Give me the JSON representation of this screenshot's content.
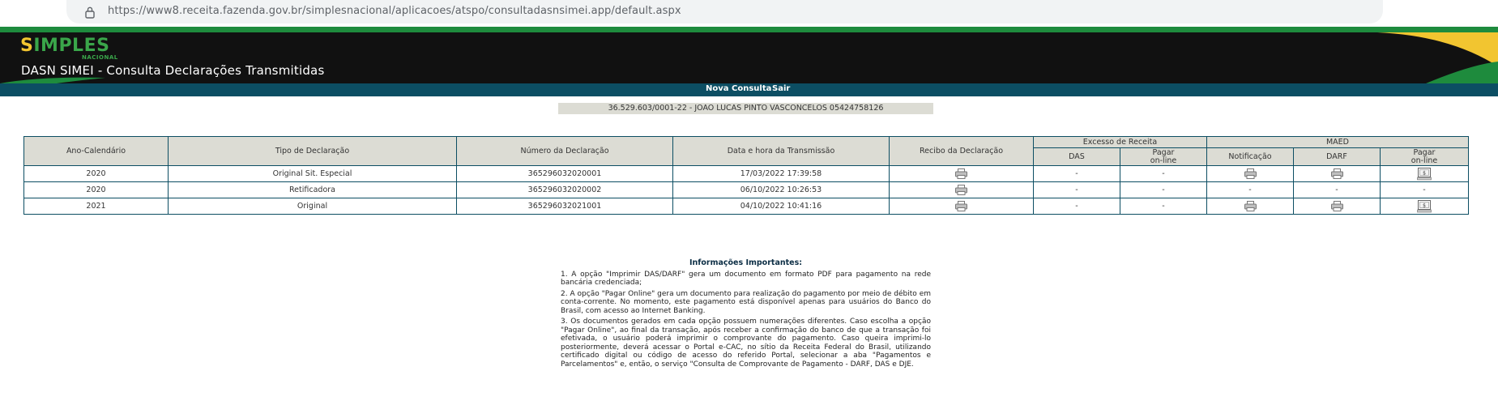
{
  "browser": {
    "url": "https://www8.receita.fazenda.gov.br/simplesnacional/aplicacoes/atspo/consultadasnsimei.app/default.aspx"
  },
  "header": {
    "logo_text": "IMPLES",
    "logo_letter": "S",
    "logo_sub": "NACIONAL",
    "title": "DASN SIMEI - Consulta Declarações Transmitidas"
  },
  "nav": {
    "new_query": "Nova Consulta",
    "exit": "Sair"
  },
  "identity": "36.529.603/0001-22 - JOAO LUCAS PINTO VASCONCELOS 05424758126",
  "table": {
    "headers": {
      "year": "Ano-Calendário",
      "type": "Tipo de Declaração",
      "number": "Número da Declaração",
      "datetime": "Data e hora da Transmissão",
      "receipt": "Recibo da Declaração",
      "excess": "Excesso de Receita",
      "excess_das": "DAS",
      "excess_pay_line1": "Pagar",
      "excess_pay_line2": "on-line",
      "maed": "MAED",
      "maed_notification": "Notificação",
      "maed_darf": "DARF",
      "maed_pay_line1": "Pagar",
      "maed_pay_line2": "on-line"
    },
    "rows": [
      {
        "year": "2020",
        "type": "Original Sit. Especial",
        "number": "365296032020001",
        "datetime": "17/03/2022 17:39:58",
        "excess_das": "-",
        "excess_pay": "-"
      },
      {
        "year": "2020",
        "type": "Retificadora",
        "number": "365296032020002",
        "datetime": "06/10/2022 10:26:53",
        "excess_das": "-",
        "excess_pay": "-",
        "maed_notification": "-",
        "maed_darf": "-",
        "maed_pay": "-"
      },
      {
        "year": "2021",
        "type": "Original",
        "number": "365296032021001",
        "datetime": "04/10/2022 10:41:16",
        "excess_das": "-",
        "excess_pay": "-"
      }
    ]
  },
  "info": {
    "title": "Informações Importantes:",
    "items": [
      "1. A opção \"Imprimir DAS/DARF\" gera um documento em formato PDF para pagamento na rede bancária credenciada;",
      "2. A opção \"Pagar Online\" gera um documento para realização do pagamento por meio de débito em conta-corrente. No momento, este pagamento está disponível apenas para usuários do Banco do Brasil, com acesso ao Internet Banking.",
      "3. Os documentos gerados em cada opção possuem numerações diferentes. Caso escolha a opção \"Pagar Online\", ao final da transação, após receber a confirmação do banco de que a transação foi efetivada, o usuário poderá imprimir o comprovante do pagamento. Caso queira imprimi-lo posteriormente, deverá acessar o Portal e-CAC, no sítio da Receita Federal do Brasil, utilizando certificado digital ou código de acesso do referido Portal, selecionar a aba \"Pagamentos e Parcelamentos\" e, então, o serviço \"Consulta de Comprovante de Pagamento - DARF, DAS e DJE."
    ]
  },
  "colors": {
    "navbar": "#0c4e63",
    "header_bg": "#111111",
    "green_stripe": "#1e8b3d",
    "table_header_bg": "#dcdcd4",
    "logo_green": "#3aa64a",
    "logo_yellow": "#f2c530"
  },
  "icons": {
    "lock": "lock-icon",
    "printer": "printer-icon",
    "pay_online": "pay-online-icon"
  }
}
